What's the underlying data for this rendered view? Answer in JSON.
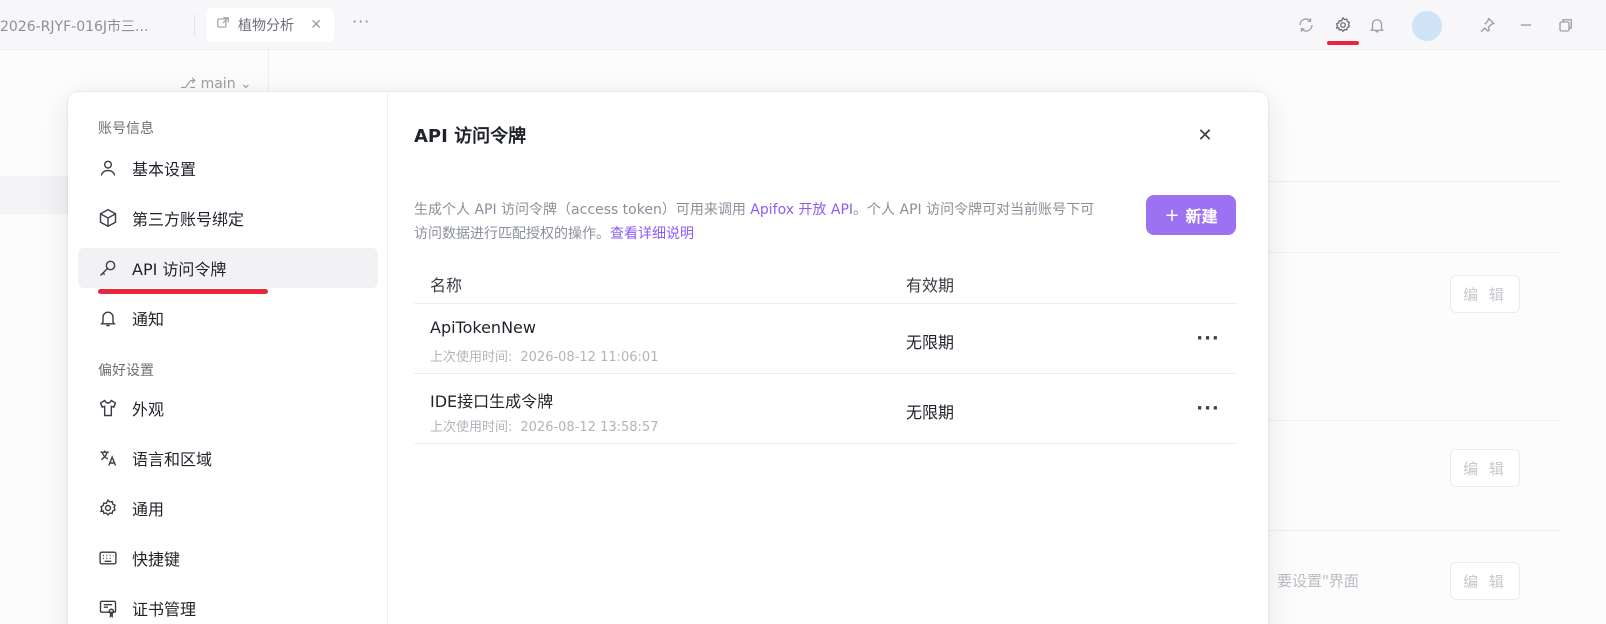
{
  "titlebar": {
    "project_name": "2026-RJYF-016J市三...",
    "tab_label": "植物分析",
    "tab_close": "✕",
    "more": "···"
  },
  "background": {
    "branch": "main",
    "edit_label": "编 辑",
    "trailing_text": "，要设置\"界面"
  },
  "sidebar": {
    "account_section": "账号信息",
    "preference_section": "偏好设置",
    "items": [
      {
        "label": "基本设置",
        "icon": "user-icon"
      },
      {
        "label": "第三方账号绑定",
        "icon": "cube-icon"
      },
      {
        "label": "API 访问令牌",
        "icon": "key-icon",
        "active": true
      },
      {
        "label": "通知",
        "icon": "bell-icon"
      },
      {
        "label": "外观",
        "icon": "shirt-icon"
      },
      {
        "label": "语言和区域",
        "icon": "translate-icon"
      },
      {
        "label": "通用",
        "icon": "gear-icon"
      },
      {
        "label": "快捷键",
        "icon": "keyboard-icon"
      },
      {
        "label": "证书管理",
        "icon": "certificate-icon"
      }
    ]
  },
  "content": {
    "title": "API 访问令牌",
    "desc_part1": "生成个人 API 访问令牌（access token）可用来调用 ",
    "desc_link1": "Apifox 开放 API",
    "desc_part2": "。个人 API 访问令牌可对当前账号下可访问数据进行匹配授权的操作。",
    "desc_link2": "查看详细说明",
    "new_button": "新建",
    "new_plus": "+",
    "columns": {
      "name": "名称",
      "expiry": "有效期"
    },
    "last_used_label": "上次使用时间:",
    "tokens": [
      {
        "name": "ApiTokenNew",
        "last_used": "2026-08-12 11:06:01",
        "expiry": "无限期"
      },
      {
        "name": "IDE接口生成令牌",
        "last_used": "2026-08-12 13:58:57",
        "expiry": "无限期"
      }
    ],
    "row_more": "···"
  },
  "colors": {
    "accent": "#9d72f2",
    "link": "#8b5cf6",
    "annotation_red": "#e8253c"
  }
}
